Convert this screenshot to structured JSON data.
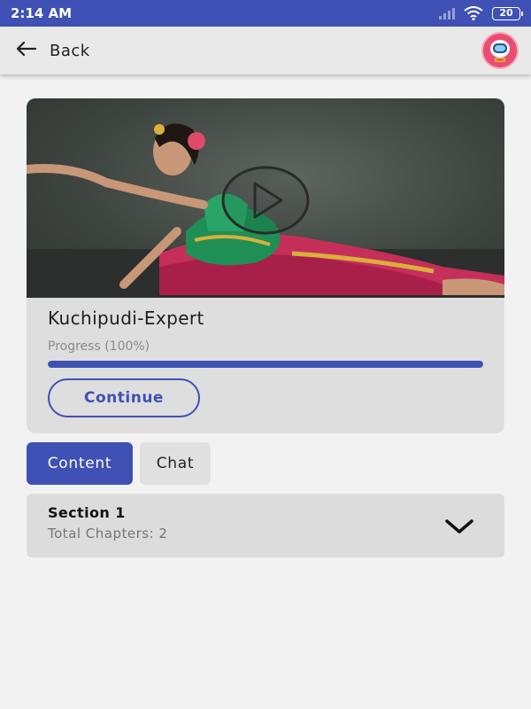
{
  "status_bar": {
    "time": "2:14 AM",
    "battery": "20",
    "icons": [
      "signal-icon",
      "wifi-icon",
      "battery-icon"
    ]
  },
  "app_bar": {
    "back_label": "Back",
    "icons": [
      "back-arrow-icon",
      "avatar-icon"
    ]
  },
  "course": {
    "title": "Kuchipudi-Expert",
    "progress_label": "Progress (100%)",
    "progress_value": 1.0,
    "continue_label": "Continue",
    "media_icon": "play-icon"
  },
  "tabs": [
    {
      "label": "Content",
      "active": true
    },
    {
      "label": "Chat",
      "active": false
    }
  ],
  "sections": [
    {
      "title": "Section 1",
      "subtitle": "Total Chapters: 2",
      "icon": "chevron-down-icon"
    }
  ],
  "colors": {
    "primary": "#3f51b5",
    "background": "#f2f2f2",
    "card": "#dedede"
  }
}
